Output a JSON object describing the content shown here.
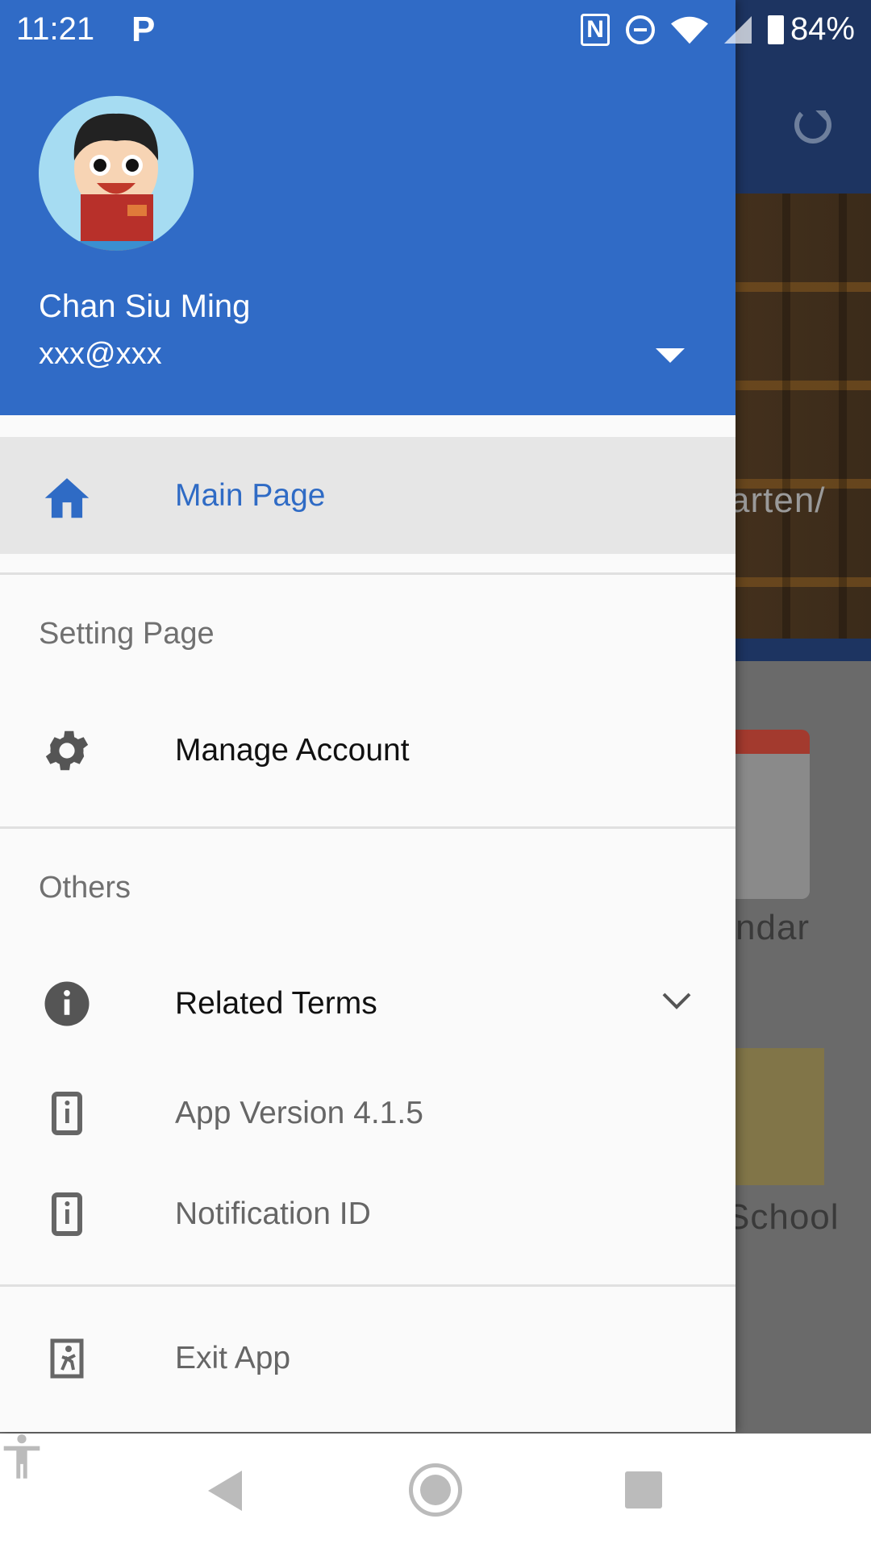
{
  "status_bar": {
    "time": "11:21",
    "notification_app": "P",
    "battery": "84%",
    "icons": [
      "nfc-icon",
      "do-not-disturb-icon",
      "wifi-icon",
      "signal-icon",
      "battery-charging-icon"
    ]
  },
  "background": {
    "banner_text": "arten/",
    "calendar_text": "ndar",
    "school_text": "School"
  },
  "drawer": {
    "user": {
      "name": "Chan Siu Ming",
      "email": "xxx@xxx"
    },
    "main_page": "Main Page",
    "setting_section": "Setting Page",
    "manage_account": "Manage Account",
    "others_section": "Others",
    "related_terms": "Related Terms",
    "app_version": "App Version 4.1.5",
    "notification_id": "Notification ID",
    "exit_app": "Exit App"
  },
  "colors": {
    "header": "#306bc6",
    "accent": "#2f6bc5",
    "selected_row": "#e6e6e6"
  }
}
